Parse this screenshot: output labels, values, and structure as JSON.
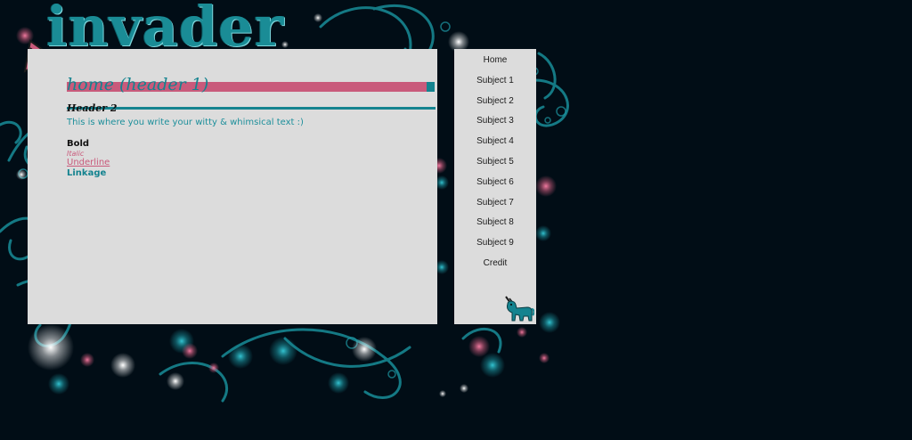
{
  "logo": {
    "title": "invader"
  },
  "main": {
    "header1": "home (header 1)",
    "header2": "Header 2",
    "intro_text": "This is where you write your witty & whimsical text :)",
    "bold_label": "Bold",
    "italic_label": "Italic",
    "underline_label": "Underline",
    "link_label": "Linkage"
  },
  "sidebar": {
    "items": [
      {
        "label": "Home"
      },
      {
        "label": "Subject 1"
      },
      {
        "label": "Subject 2"
      },
      {
        "label": "Subject 3"
      },
      {
        "label": "Subject 4"
      },
      {
        "label": "Subject 5"
      },
      {
        "label": "Subject 6"
      },
      {
        "label": "Subject 7"
      },
      {
        "label": "Subject 8"
      },
      {
        "label": "Subject 9"
      },
      {
        "label": "Credit"
      }
    ]
  },
  "icons": {
    "logo_arrow": "arrow-icon",
    "mascot": "unicorn-icon"
  },
  "colors": {
    "background": "#010d16",
    "panel": "#dcdcdc",
    "teal": "#14838f",
    "pink": "#c95a7b"
  }
}
